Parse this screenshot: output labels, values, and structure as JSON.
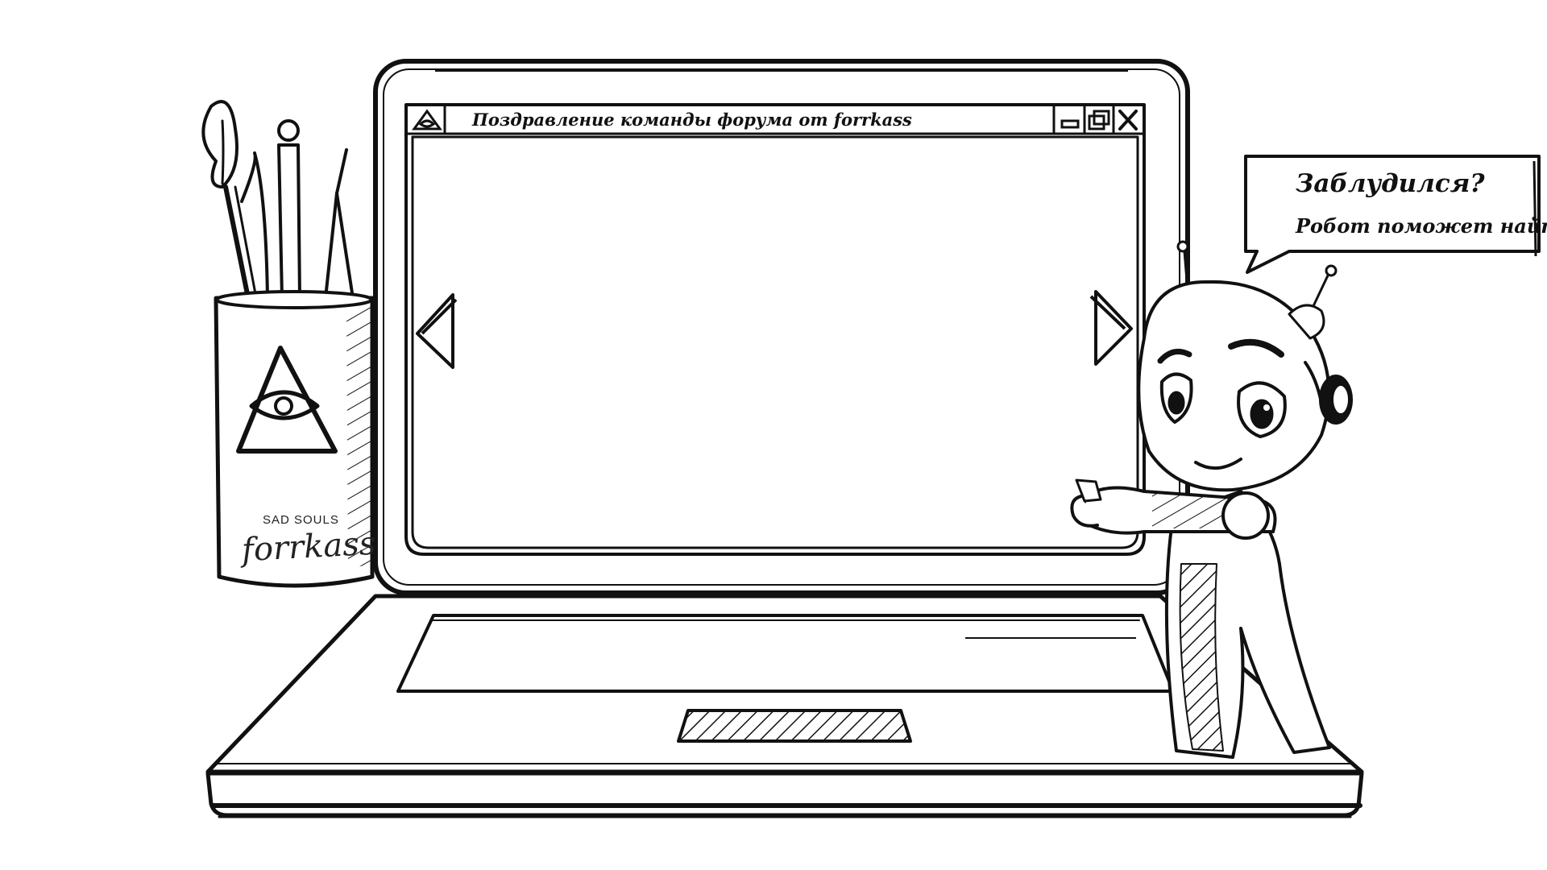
{
  "window": {
    "title": "Поздравление команды форума от forrkass",
    "icon": "eye-triangle-icon",
    "controls": {
      "minimize_icon": "minimize-icon",
      "maximize_icon": "maximize-icon",
      "close_icon": "close-icon"
    },
    "nav": {
      "prev_icon": "triangle-left-icon",
      "next_icon": "triangle-right-icon"
    }
  },
  "speech_bubble": {
    "line1": "Заблудился?",
    "line2": "Робот поможет найти!"
  },
  "mug": {
    "logo_icon": "eye-triangle-icon",
    "text_top": "SAD SOULS",
    "text_logo": "forrkass"
  },
  "colors": {
    "ink": "#111111",
    "paper": "#ffffff"
  }
}
